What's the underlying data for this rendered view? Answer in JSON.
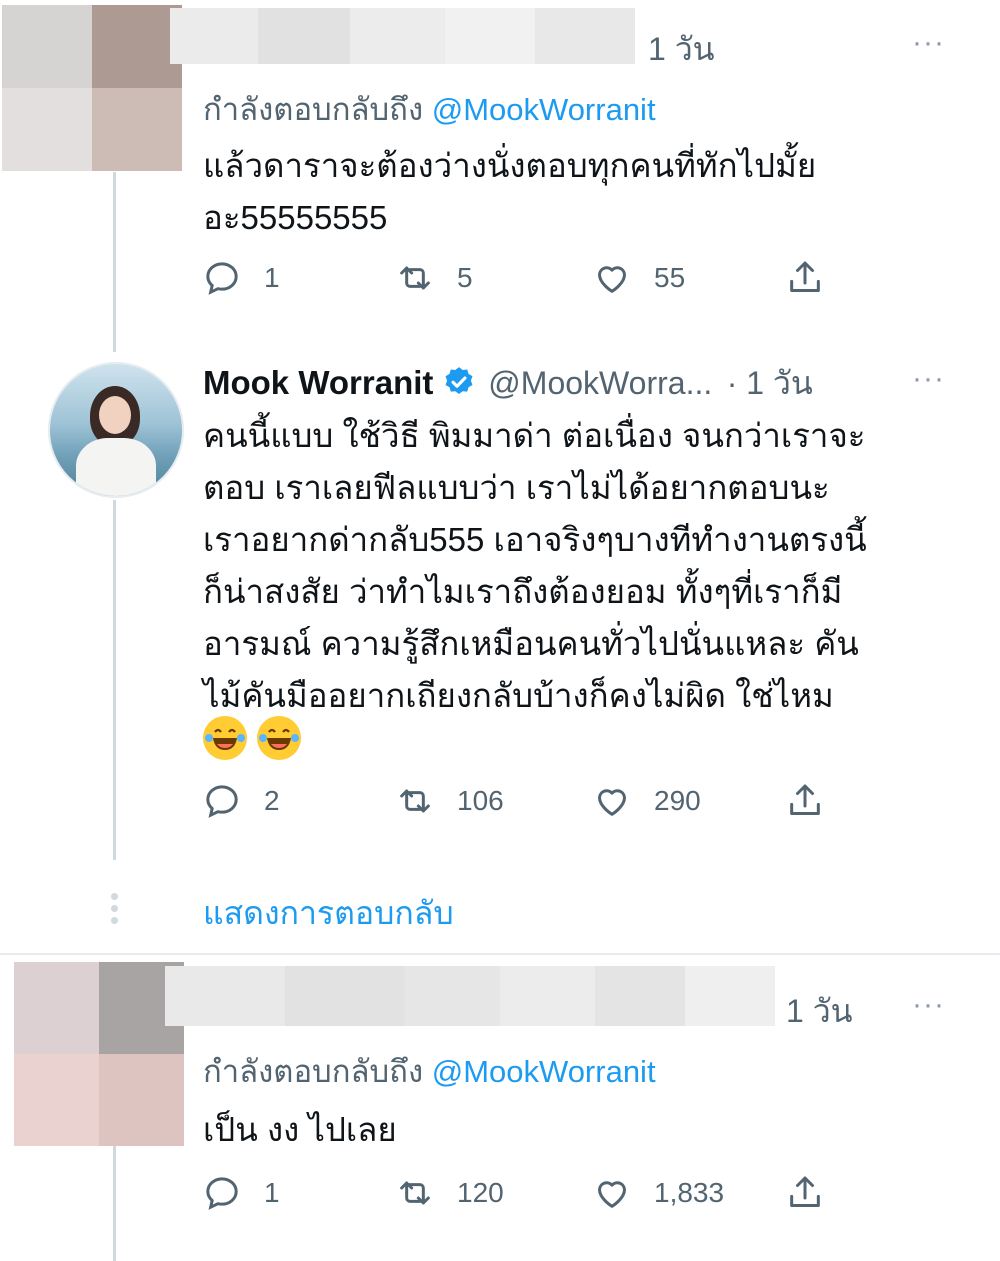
{
  "tweets": [
    {
      "time": "1 วัน",
      "more": "···",
      "reply_label": "กำลังตอบกลับถึง",
      "reply_handle": "@MookWorranit",
      "text": "แล้วดาราจะต้องว่างนั่งตอบทุกคนที่ทักไปมั้ย\nอะ55555555",
      "replies": "1",
      "retweets": "5",
      "likes": "55"
    },
    {
      "name": "Mook Worranit",
      "handle": "@MookWorra...",
      "time": "· 1 วัน",
      "more": "···",
      "text": "คนนี้แบบ ใช้วิธี พิมมาด่า ต่อเนื่อง จนกว่าเราจะ\nตอบ เราเลยฟีลแบบว่า เราไม่ได้อยากตอบนะ\nเราอยากด่ากลับ555 เอาจริงๆบางทีทำงานตรงนี้\nก็น่าสงสัย ว่าทำไมเราถึงต้องยอม ทั้งๆที่เราก็มี\nอารมณ์ ความรู้สึกเหมือนคนทั่วไปนั่นแหละ คัน\nไม้คันมืออยากเถียงกลับบ้างก็คงไม่ผิด ใช่ไหม",
      "replies": "2",
      "retweets": "106",
      "likes": "290"
    },
    {
      "time": "1 วัน",
      "more": "···",
      "reply_label": "กำลังตอบกลับถึง",
      "reply_handle": "@MookWorranit",
      "text": "เป็น งง ไปเลย",
      "replies": "1",
      "retweets": "120",
      "likes": "1,833"
    }
  ],
  "show_replies": "แสดงการตอบกลับ",
  "colors": {
    "link": "#1d9bf0",
    "verified": "#1d9bf0",
    "secondary": "#536471"
  }
}
